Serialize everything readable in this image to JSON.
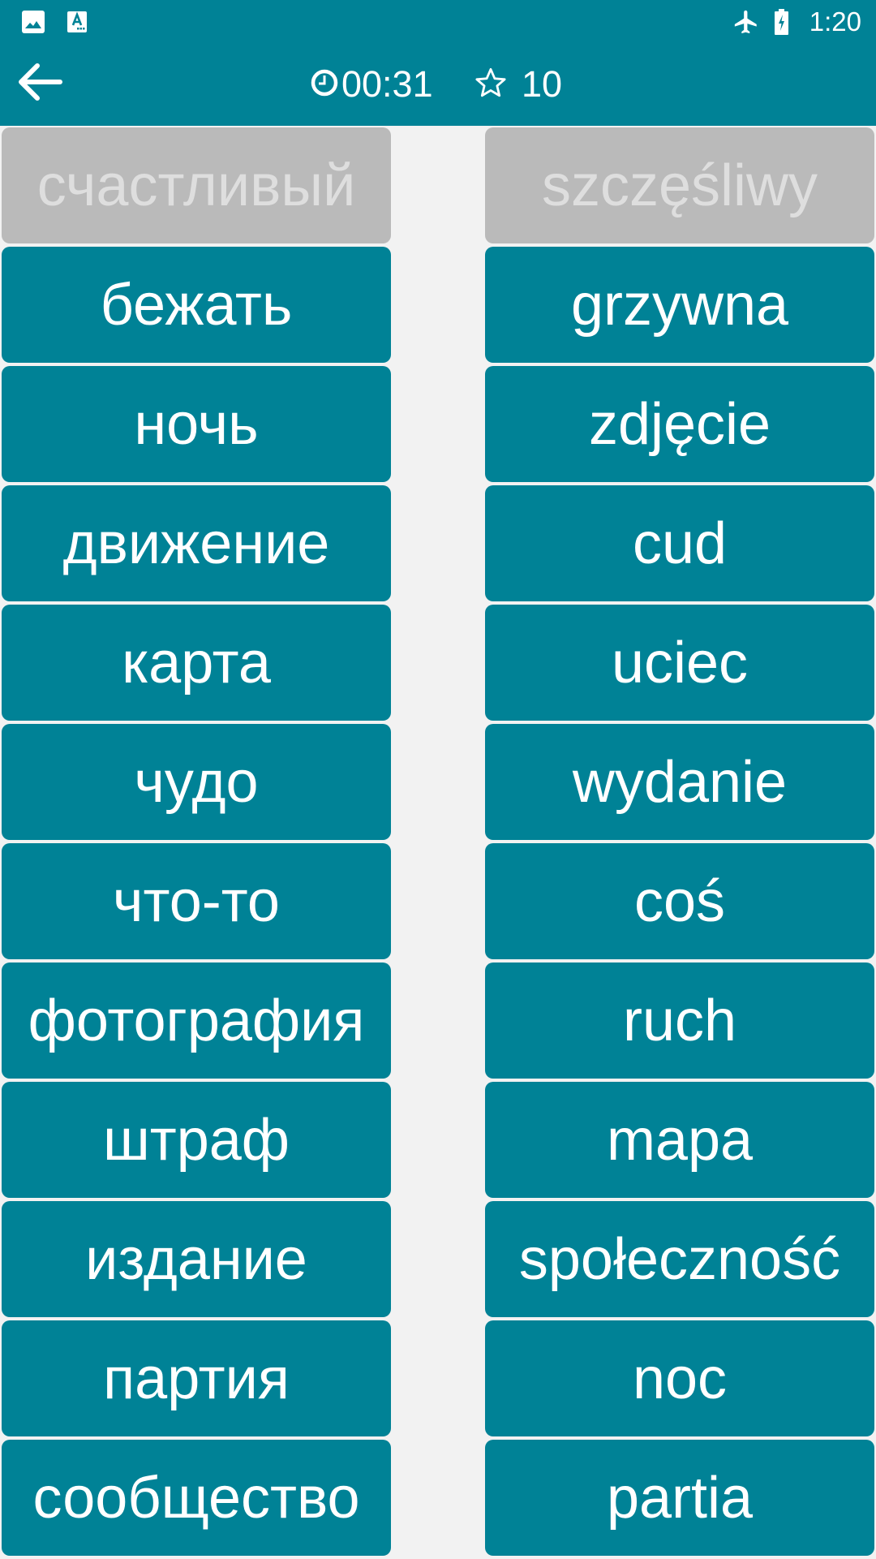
{
  "status_bar": {
    "time": "1:20",
    "left_icons": [
      "image-icon",
      "accessibility-font-icon"
    ],
    "right_icons": [
      "airplane-mode-icon",
      "battery-charging-icon"
    ]
  },
  "app_bar": {
    "back_icon": "arrow-left-icon",
    "timer_icon": "clock-icon",
    "timer": "00:31",
    "score_icon": "star-outline-icon",
    "score": "10"
  },
  "colors": {
    "primary": "#008296",
    "background": "#f2f2f2",
    "matched_tile": "#bababa",
    "matched_text": "#dedede",
    "tile_text": "#ffffff"
  },
  "board": {
    "left_column": [
      {
        "word": "счастливый",
        "state": "matched"
      },
      {
        "word": "бежать",
        "state": "active"
      },
      {
        "word": "ночь",
        "state": "active"
      },
      {
        "word": "движение",
        "state": "active"
      },
      {
        "word": "карта",
        "state": "active"
      },
      {
        "word": "чудо",
        "state": "active"
      },
      {
        "word": "что-то",
        "state": "active"
      },
      {
        "word": "фотография",
        "state": "active"
      },
      {
        "word": "штраф",
        "state": "active"
      },
      {
        "word": "издание",
        "state": "active"
      },
      {
        "word": "партия",
        "state": "active"
      },
      {
        "word": "сообщество",
        "state": "active"
      }
    ],
    "right_column": [
      {
        "word": "szczęśliwy",
        "state": "matched"
      },
      {
        "word": "grzywna",
        "state": "active"
      },
      {
        "word": "zdjęcie",
        "state": "active"
      },
      {
        "word": "cud",
        "state": "active"
      },
      {
        "word": "uciec",
        "state": "active"
      },
      {
        "word": "wydanie",
        "state": "active"
      },
      {
        "word": "coś",
        "state": "active"
      },
      {
        "word": "ruch",
        "state": "active"
      },
      {
        "word": "mapa",
        "state": "active"
      },
      {
        "word": "społeczność",
        "state": "active"
      },
      {
        "word": "noc",
        "state": "active"
      },
      {
        "word": "partia",
        "state": "active"
      }
    ]
  }
}
